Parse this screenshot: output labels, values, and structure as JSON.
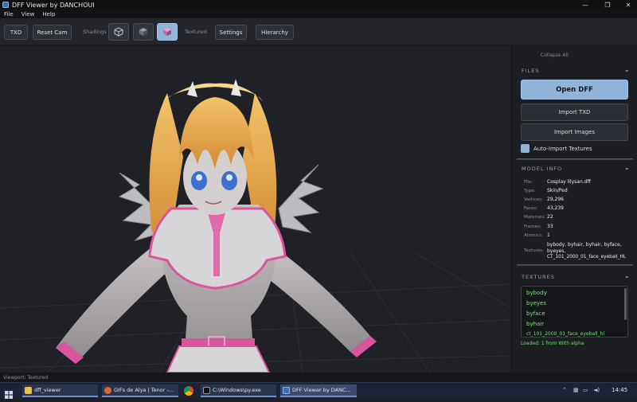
{
  "window": {
    "title": "DFF Viewer by DANCHOUI",
    "minimize": "—",
    "restore": "❐",
    "close": "✕"
  },
  "menu": [
    "File",
    "View",
    "Help"
  ],
  "toolbar": {
    "txd": "TXD",
    "reset_cam": "Reset Cam",
    "shadings_label": "Shadings",
    "textured_label": "Textured",
    "settings": "Settings",
    "hierarchy": "Hierarchy"
  },
  "panel": {
    "collapse_all": "Collapse All",
    "files": {
      "header": "FILES",
      "open_dff": "Open DFF",
      "import_txd": "Import TXD",
      "import_images": "Import Images",
      "auto_import": "Auto-Import Textures",
      "auto_import_checked": true
    },
    "model_info": {
      "header": "MODEL INFO",
      "rows": [
        {
          "k": "File:",
          "v": "Cosplay lilysan.dff"
        },
        {
          "k": "Type:",
          "v": "Skin/Ped"
        },
        {
          "k": "Vertices:",
          "v": "29,296"
        },
        {
          "k": "Faces:",
          "v": "43,239"
        },
        {
          "k": "Materials:",
          "v": "22"
        },
        {
          "k": "Frames:",
          "v": "33"
        },
        {
          "k": "Atomics:",
          "v": "1"
        }
      ],
      "textures_key": "Textures:",
      "textures_lines": [
        "bybody, byhair, byhair, byface,",
        "byeyes,",
        "CT_101_2000_01_face_eyeball_HL"
      ]
    },
    "textures": {
      "header": "TEXTURES",
      "items": [
        "bybody",
        "byeyes",
        "byface",
        "byhair",
        "ct_101_2000_01_face_eyeball_hl"
      ],
      "status": "Loaded: 1 from With alpha"
    }
  },
  "status_bar": "Viewport: Textured",
  "taskbar": {
    "items": [
      "dff_viewer",
      "GIFs de Alya | Tenor -...",
      "C:\\Windows\\py.exe",
      "DFF Viewer by DANC..."
    ],
    "clock": "14:45"
  },
  "colors": {
    "accent": "#8fb3d9",
    "texture_text": "#7ee07e",
    "viewport_bg": "#202127",
    "panel_bg": "#1d1e22"
  }
}
